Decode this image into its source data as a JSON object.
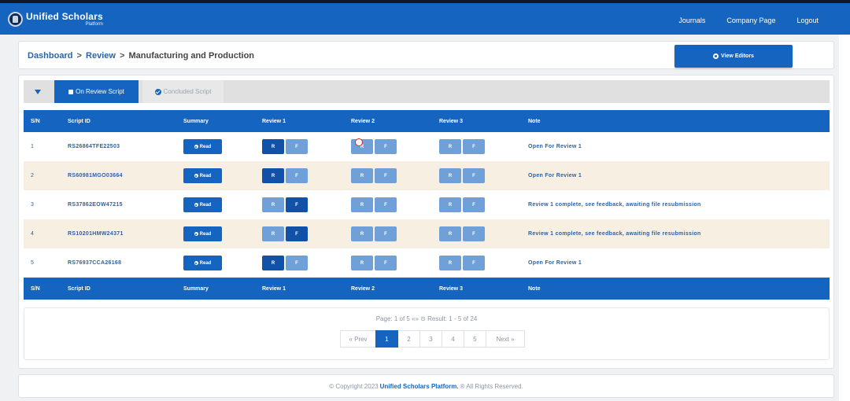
{
  "header": {
    "brand_name": "Unified Scholars",
    "brand_sub": "Platform",
    "nav": [
      "Journals",
      "Company Page",
      "Logout"
    ]
  },
  "breadcrumb": {
    "items": [
      "Dashboard",
      "Review",
      "Manufacturing and Production"
    ],
    "separator": ">"
  },
  "view_editors_label": "View Editors",
  "filter_tabs": {
    "active": "On Review Script",
    "inactive": "Concluded Script"
  },
  "table": {
    "columns": [
      "S/N",
      "Script ID",
      "Summary",
      "Review 1",
      "Review 2",
      "Review 3",
      "Note"
    ],
    "read_label": "Read",
    "r_label": "R",
    "f_label": "F",
    "rows": [
      {
        "sn": "1",
        "script_id": "RS26864TFE22503",
        "note": "Open For Review 1"
      },
      {
        "sn": "2",
        "script_id": "RS60981MGO03664",
        "note": "Open For Review 1"
      },
      {
        "sn": "3",
        "script_id": "RS37862EOW47215",
        "note": "Review 1 complete, see feedback, awaiting file resubmission"
      },
      {
        "sn": "4",
        "script_id": "RS10201HMW24371",
        "note": "Review 1 complete, see feedback, awaiting file resubmission"
      },
      {
        "sn": "5",
        "script_id": "RS76937CCA26168",
        "note": "Open For Review 1"
      }
    ]
  },
  "pagination": {
    "summary": "Page: 1 of 5 «» ⊙ Result: 1 - 5 of 24",
    "prev": "« Prev",
    "pages": [
      "1",
      "2",
      "3",
      "4",
      "5"
    ],
    "active_page": "1",
    "next": "Next »"
  },
  "footer": {
    "prefix": "© Copyright 2023",
    "brand": "Unified Scholars Platform.",
    "suffix": "® All Rights Reserved."
  },
  "colors": {
    "primary": "#1565c0",
    "active_button": "#1251a8",
    "inactive_button": "#6fa0d8",
    "row_alt": "#f7f0e2"
  }
}
